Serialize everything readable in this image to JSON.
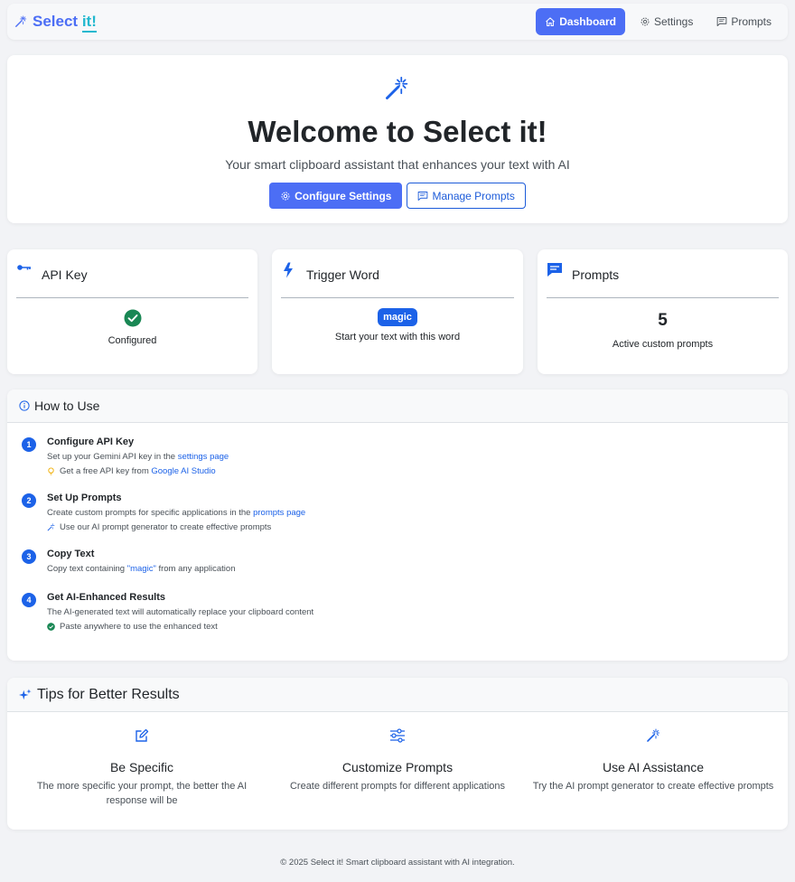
{
  "brand": {
    "name": "Select",
    "accent": "it!"
  },
  "nav": [
    {
      "label": "Dashboard",
      "icon": "house-icon",
      "active": true
    },
    {
      "label": "Settings",
      "icon": "gear-icon",
      "active": false
    },
    {
      "label": "Prompts",
      "icon": "chat-lines-icon",
      "active": false
    }
  ],
  "hero": {
    "title": "Welcome to Select it!",
    "subtitle": "Your smart clipboard assistant that enhances your text with AI",
    "configure_label": "Configure Settings",
    "manage_label": "Manage Prompts"
  },
  "stats": {
    "api_key": {
      "title": "API Key",
      "status": "Configured"
    },
    "trigger": {
      "title": "Trigger Word",
      "word": "magic",
      "desc": "Start your text with this word"
    },
    "prompts": {
      "title": "Prompts",
      "count": "5",
      "desc": "Active custom prompts"
    }
  },
  "howto": {
    "title": "How to Use",
    "steps": [
      {
        "num": "1",
        "title": "Configure API Key",
        "desc_pre": "Set up your Gemini API key in the ",
        "desc_link": "settings page",
        "hint_pre": "Get a free API key from ",
        "hint_link": "Google AI Studio"
      },
      {
        "num": "2",
        "title": "Set Up Prompts",
        "desc_pre": "Create custom prompts for specific applications in the ",
        "desc_link": "prompts page",
        "hint": "Use our AI prompt generator to create effective prompts"
      },
      {
        "num": "3",
        "title": "Copy Text",
        "desc_pre": "Copy text containing ",
        "desc_link": "\"magic\"",
        "desc_post": " from any application"
      },
      {
        "num": "4",
        "title": "Get AI-Enhanced Results",
        "desc": "The AI-generated text will automatically replace your clipboard content",
        "hint": "Paste anywhere to use the enhanced text"
      }
    ]
  },
  "tips": {
    "title": "Tips for Better Results",
    "items": [
      {
        "title": "Be Specific",
        "desc": "The more specific your prompt, the better the AI response will be",
        "icon": "pencil-square-icon"
      },
      {
        "title": "Customize Prompts",
        "desc": "Create different prompts for different applications",
        "icon": "sliders-icon"
      },
      {
        "title": "Use AI Assistance",
        "desc": "Try the AI prompt generator to create effective prompts",
        "icon": "magic-wand-icon"
      }
    ]
  },
  "footer": "© 2025 Select it! Smart clipboard assistant with AI integration.",
  "colors": {
    "primary": "#4c6ef5",
    "link": "#1c62e8",
    "accent": "#22b8cf",
    "success": "#198754",
    "warning": "#f0ad00"
  }
}
